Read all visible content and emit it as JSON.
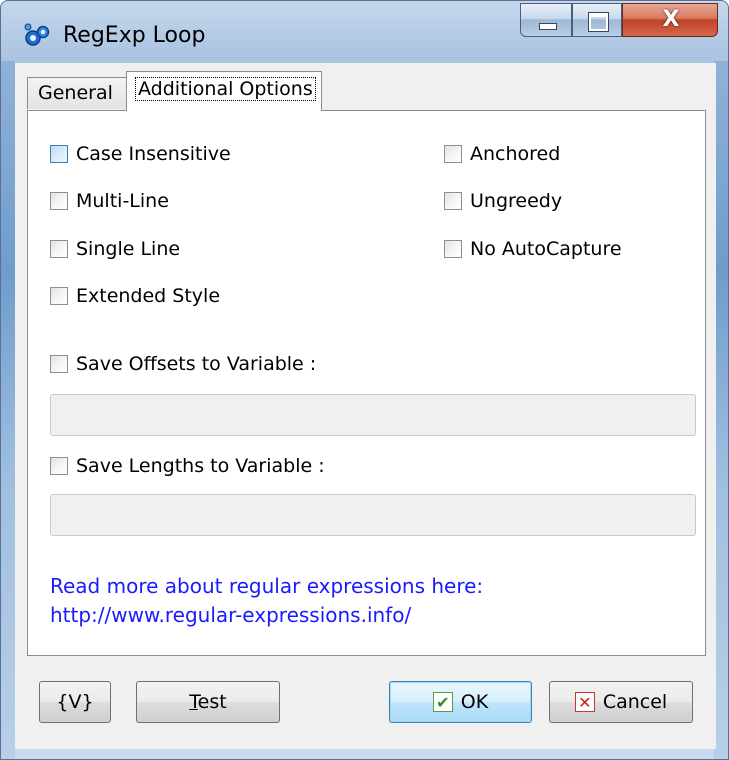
{
  "window": {
    "title": "RegExp Loop"
  },
  "caption_buttons": {
    "close_glyph": "X"
  },
  "tabs": [
    {
      "label": "General"
    },
    {
      "label": "Additional Options"
    }
  ],
  "options_left": [
    {
      "label": "Case Insensitive",
      "checked": false
    },
    {
      "label": "Multi-Line",
      "checked": false
    },
    {
      "label": "Single Line",
      "checked": false
    },
    {
      "label": "Extended Style",
      "checked": false
    }
  ],
  "options_right": [
    {
      "label": "Anchored",
      "checked": false
    },
    {
      "label": "Ungreedy",
      "checked": false
    },
    {
      "label": "No AutoCapture",
      "checked": false
    }
  ],
  "save_offsets": {
    "label": "Save Offsets to Variable :",
    "checked": false,
    "value": ""
  },
  "save_lengths": {
    "label": "Save Lengths to Variable :",
    "checked": false,
    "value": ""
  },
  "info": {
    "line1": "Read more about regular expressions here:",
    "line2": "http://www.regular-expressions.info/"
  },
  "buttons": {
    "variables": "{V}",
    "test_first": "T",
    "test_rest": "est",
    "ok": "OK",
    "cancel": "Cancel"
  },
  "colors": {
    "link": "#1a1aff",
    "ok_icon": "#2f8f1f",
    "cancel_icon": "#d21e12"
  },
  "icons": {
    "app": "regexp-loop-app-icon",
    "ok": "check-icon",
    "cancel": "x-icon"
  }
}
